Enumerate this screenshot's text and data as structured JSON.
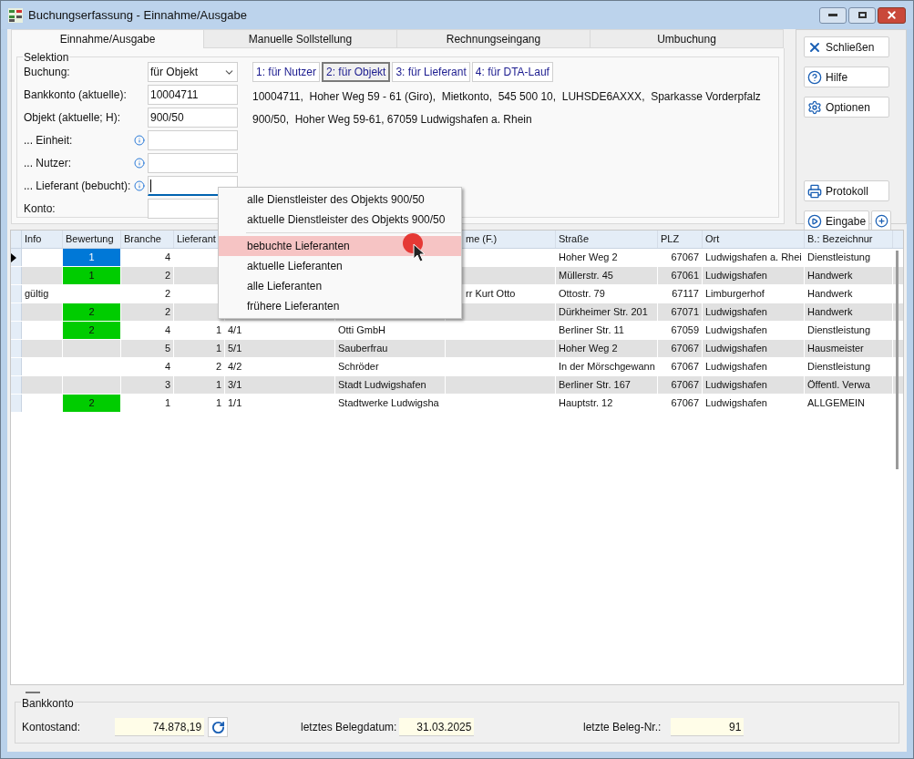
{
  "window": {
    "title": "Buchungserfassung - Einnahme/Ausgabe"
  },
  "tabs": [
    {
      "label": "Einnahme/Ausgabe",
      "selected": true
    },
    {
      "label": "Manuelle Sollstellung",
      "selected": false
    },
    {
      "label": "Rechnungseingang",
      "selected": false
    },
    {
      "label": "Umbuchung",
      "selected": false
    }
  ],
  "selection": {
    "title": "Selektion",
    "fields": [
      {
        "label": "Buchung:",
        "kind": "dropdown",
        "value": "für Objekt",
        "info": false,
        "focused": false
      },
      {
        "label": "Bankkonto (aktuelle):",
        "kind": "text",
        "value": "10004711",
        "info": false,
        "focused": false
      },
      {
        "label": "Objekt (aktuelle; H):",
        "kind": "text",
        "value": "900/50",
        "info": false,
        "focused": false
      },
      {
        "label": "... Einheit:",
        "kind": "text",
        "info": true,
        "focused": false
      },
      {
        "label": "... Nutzer:",
        "kind": "text",
        "info": true,
        "focused": false
      },
      {
        "label": "... Lieferant (bebucht):",
        "kind": "text",
        "info": true,
        "focused": true
      },
      {
        "label": "Konto:",
        "kind": "text",
        "info": false,
        "focused": false
      }
    ],
    "mode_buttons": [
      {
        "label": "1: für Nutzer",
        "selected": false
      },
      {
        "label": "2: für Objekt",
        "selected": true
      },
      {
        "label": "3: für Lieferant",
        "selected": false
      },
      {
        "label": "4: für DTA-Lauf",
        "selected": false
      }
    ],
    "info_lines": [
      "10004711,  Hoher Weg 59 - 61 (Giro),  Mietkonto,  545 500 10,  LUHSDE6AXXX,  Sparkasse Vorderpfalz",
      "900/50,  Hoher Weg 59-61, 67059 Ludwigshafen a. Rhein"
    ]
  },
  "side_buttons": [
    {
      "label": "Schließen",
      "kind": "close",
      "extra": false
    },
    {
      "label": "Hilfe",
      "kind": "help",
      "extra": false
    },
    {
      "label": "Optionen",
      "kind": "settings",
      "extra": false
    },
    {
      "label": "Protokoll",
      "kind": "print",
      "extra": false
    },
    {
      "label": "Eingabe",
      "kind": "play",
      "extra": true
    }
  ],
  "context_menu": {
    "items": [
      {
        "label": "alle Dienstleister des Objekts 900/50",
        "selected": false,
        "separator_after": false
      },
      {
        "label": "aktuelle Dienstleister des Objekts 900/50",
        "selected": false,
        "separator_after": true
      },
      {
        "label": "bebuchte Lieferanten",
        "selected": true,
        "separator_after": false
      },
      {
        "label": "aktuelle Lieferanten",
        "selected": false,
        "separator_after": false
      },
      {
        "label": "alle Lieferanten",
        "selected": false,
        "separator_after": false
      },
      {
        "label": "frühere Lieferanten",
        "selected": false,
        "separator_after": false
      }
    ]
  },
  "table": {
    "columns": [
      "Info",
      "Bewertung",
      "Branche",
      "Lieferant",
      null,
      null,
      "me (F.)",
      "Straße",
      "PLZ",
      "Ort",
      "B.: Bezeichnur"
    ],
    "rows": [
      {
        "current": true,
        "color": "#0078d7",
        "cells": [
          null,
          "1",
          "4",
          null,
          null,
          null,
          null,
          "Hoher Weg 2",
          "67067",
          "Ludwigshafen a. Rhei",
          "Dienstleistung"
        ]
      },
      {
        "current": false,
        "color": "#00cc00",
        "cells": [
          null,
          "1",
          "2",
          null,
          null,
          null,
          null,
          "Müllerstr. 45",
          "67061",
          "Ludwigshafen",
          "Handwerk"
        ]
      },
      {
        "current": false,
        "cells": [
          "gültig",
          null,
          "2",
          null,
          null,
          null,
          "rr Kurt Otto",
          "Ottostr. 79",
          "67117",
          "Limburgerhof",
          "Handwerk"
        ]
      },
      {
        "current": false,
        "color": "#00cc00",
        "cells": [
          null,
          "2",
          "2",
          null,
          null,
          null,
          null,
          "Dürkheimer Str. 201",
          "67071",
          "Ludwigshafen",
          "Handwerk"
        ]
      },
      {
        "current": false,
        "color": "#00cc00",
        "cells": [
          null,
          "2",
          "4",
          "1",
          "4/1",
          "Otti GmbH",
          null,
          "Berliner Str. 11",
          "67059",
          "Ludwigshafen",
          "Dienstleistung"
        ]
      },
      {
        "current": false,
        "cells": [
          null,
          null,
          "5",
          "1",
          "5/1",
          "Sauberfrau",
          null,
          "Hoher Weg 2",
          "67067",
          "Ludwigshafen",
          "Hausmeister"
        ]
      },
      {
        "current": false,
        "cells": [
          null,
          null,
          "4",
          "2",
          "4/2",
          "Schröder",
          null,
          "In der Mörschgewann",
          "67067",
          "Ludwigshafen",
          "Dienstleistung"
        ]
      },
      {
        "current": false,
        "cells": [
          null,
          null,
          "3",
          "1",
          "3/1",
          "Stadt Ludwigshafen",
          null,
          "Berliner Str. 167",
          "67067",
          "Ludwigshafen",
          "Öffentl. Verwa"
        ]
      },
      {
        "current": false,
        "color": "#00cc00",
        "cells": [
          null,
          "2",
          "1",
          "1",
          "1/1",
          "Stadtwerke Ludwigsha",
          null,
          "Hauptstr. 12",
          "67067",
          "Ludwigshafen",
          "ALLGEMEIN"
        ]
      }
    ]
  },
  "footer": {
    "title": "Bankkonto",
    "fields": [
      {
        "label": "Kontostand:",
        "value": "74.878,19",
        "refresh": true
      },
      {
        "label": "letztes Belegdatum:",
        "value": "31.03.2025",
        "refresh": false
      },
      {
        "label": "letzte Beleg-Nr.:",
        "value": "91",
        "refresh": false
      }
    ]
  }
}
